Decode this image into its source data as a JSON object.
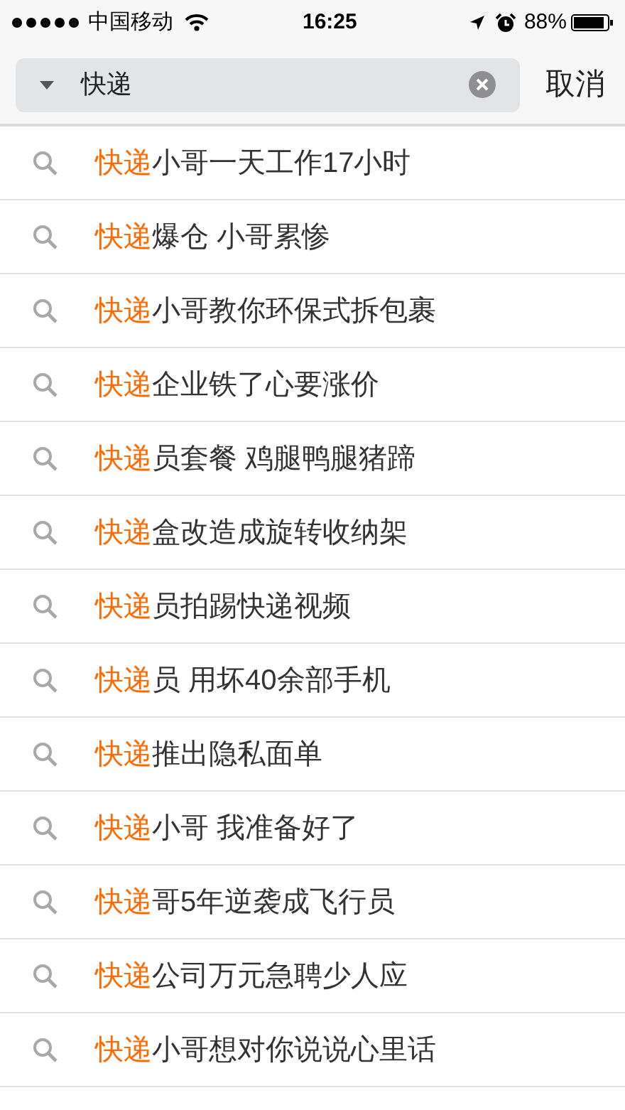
{
  "status_bar": {
    "carrier": "中国移动",
    "time": "16:25",
    "battery": "88%"
  },
  "search": {
    "value": "快递",
    "cancel": "取消"
  },
  "suggestions": [
    {
      "highlight": "快递",
      "rest": "小哥一天工作17小时"
    },
    {
      "highlight": "快递",
      "rest": "爆仓 小哥累惨"
    },
    {
      "highlight": "快递",
      "rest": "小哥教你环保式拆包裹"
    },
    {
      "highlight": "快递",
      "rest": "企业铁了心要涨价"
    },
    {
      "highlight": "快递",
      "rest": "员套餐 鸡腿鸭腿猪蹄"
    },
    {
      "highlight": "快递",
      "rest": "盒改造成旋转收纳架"
    },
    {
      "highlight": "快递",
      "rest": "员拍踢快递视频"
    },
    {
      "highlight": "快递",
      "rest": "员 用坏40余部手机"
    },
    {
      "highlight": "快递",
      "rest": "推出隐私面单"
    },
    {
      "highlight": "快递",
      "rest": "小哥 我准备好了"
    },
    {
      "highlight": "快递",
      "rest": "哥5年逆袭成飞行员"
    },
    {
      "highlight": "快递",
      "rest": "公司万元急聘少人应"
    },
    {
      "highlight": "快递",
      "rest": "小哥想对你说说心里话"
    }
  ]
}
